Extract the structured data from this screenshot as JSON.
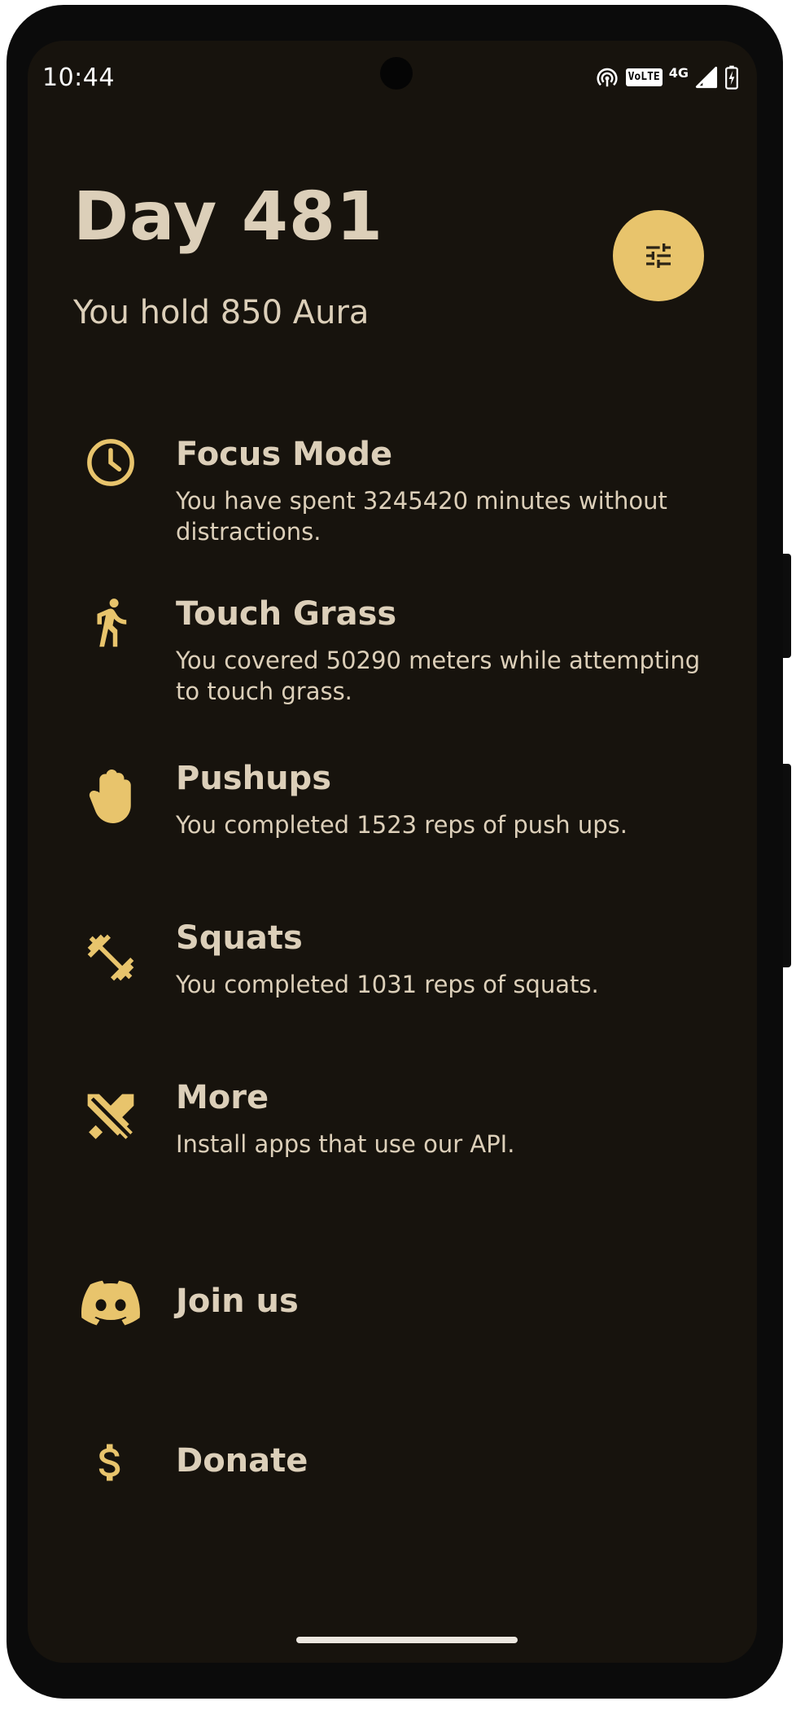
{
  "status_bar": {
    "time": "10:44",
    "volte_label": "VoLTE",
    "network_label": "4G"
  },
  "header": {
    "title": "Day 481",
    "subtitle": "You hold 850 Aura",
    "settings_icon": "tune-sliders-icon"
  },
  "items": [
    {
      "icon": "clock-icon",
      "title": "Focus Mode",
      "description": "You have spent 3245420 minutes without distractions."
    },
    {
      "icon": "running-person-icon",
      "title": "Touch Grass",
      "description": "You covered 50290 meters while attempting to touch grass."
    },
    {
      "icon": "hand-icon",
      "title": "Pushups",
      "description": "You completed 1523 reps of push ups."
    },
    {
      "icon": "dumbbell-icon",
      "title": "Squats",
      "description": "You completed 1031 reps of squats."
    },
    {
      "icon": "crossed-swords-icon",
      "title": "More",
      "description": "Install apps that use our API."
    },
    {
      "icon": "discord-icon",
      "title": "Join us",
      "description": ""
    },
    {
      "icon": "dollar-icon",
      "title": "Donate",
      "description": ""
    }
  ],
  "colors": {
    "background": "#17130d",
    "accent": "#e8c46c",
    "text": "#dccfb9"
  }
}
